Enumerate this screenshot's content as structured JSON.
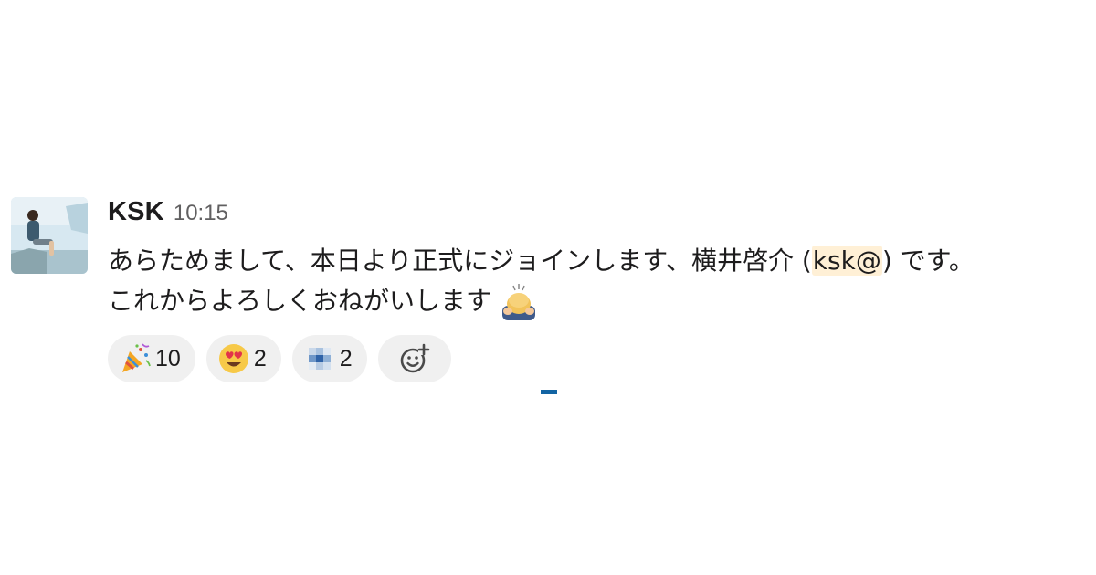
{
  "message": {
    "author": "KSK",
    "time": "10:15",
    "line1_before_mention": "あらためまして、本日より正式にジョインします、横井啓介 (",
    "mention": "ksk@",
    "line1_after_mention": ") です。",
    "line2": "これからよろしくおねがいします",
    "inline_emoji": "bowing-person-emoji"
  },
  "reactions": [
    {
      "emoji": "party-popper-emoji",
      "count": "10"
    },
    {
      "emoji": "heart-eyes-emoji",
      "count": "2"
    },
    {
      "emoji": "custom-pixel-emoji",
      "count": "2"
    }
  ],
  "add_reaction": {
    "icon": "add-reaction-icon"
  },
  "colors": {
    "mention_bg": "#fff0d6",
    "reaction_bg": "#f0f0f0",
    "accent": "#1264a3"
  }
}
